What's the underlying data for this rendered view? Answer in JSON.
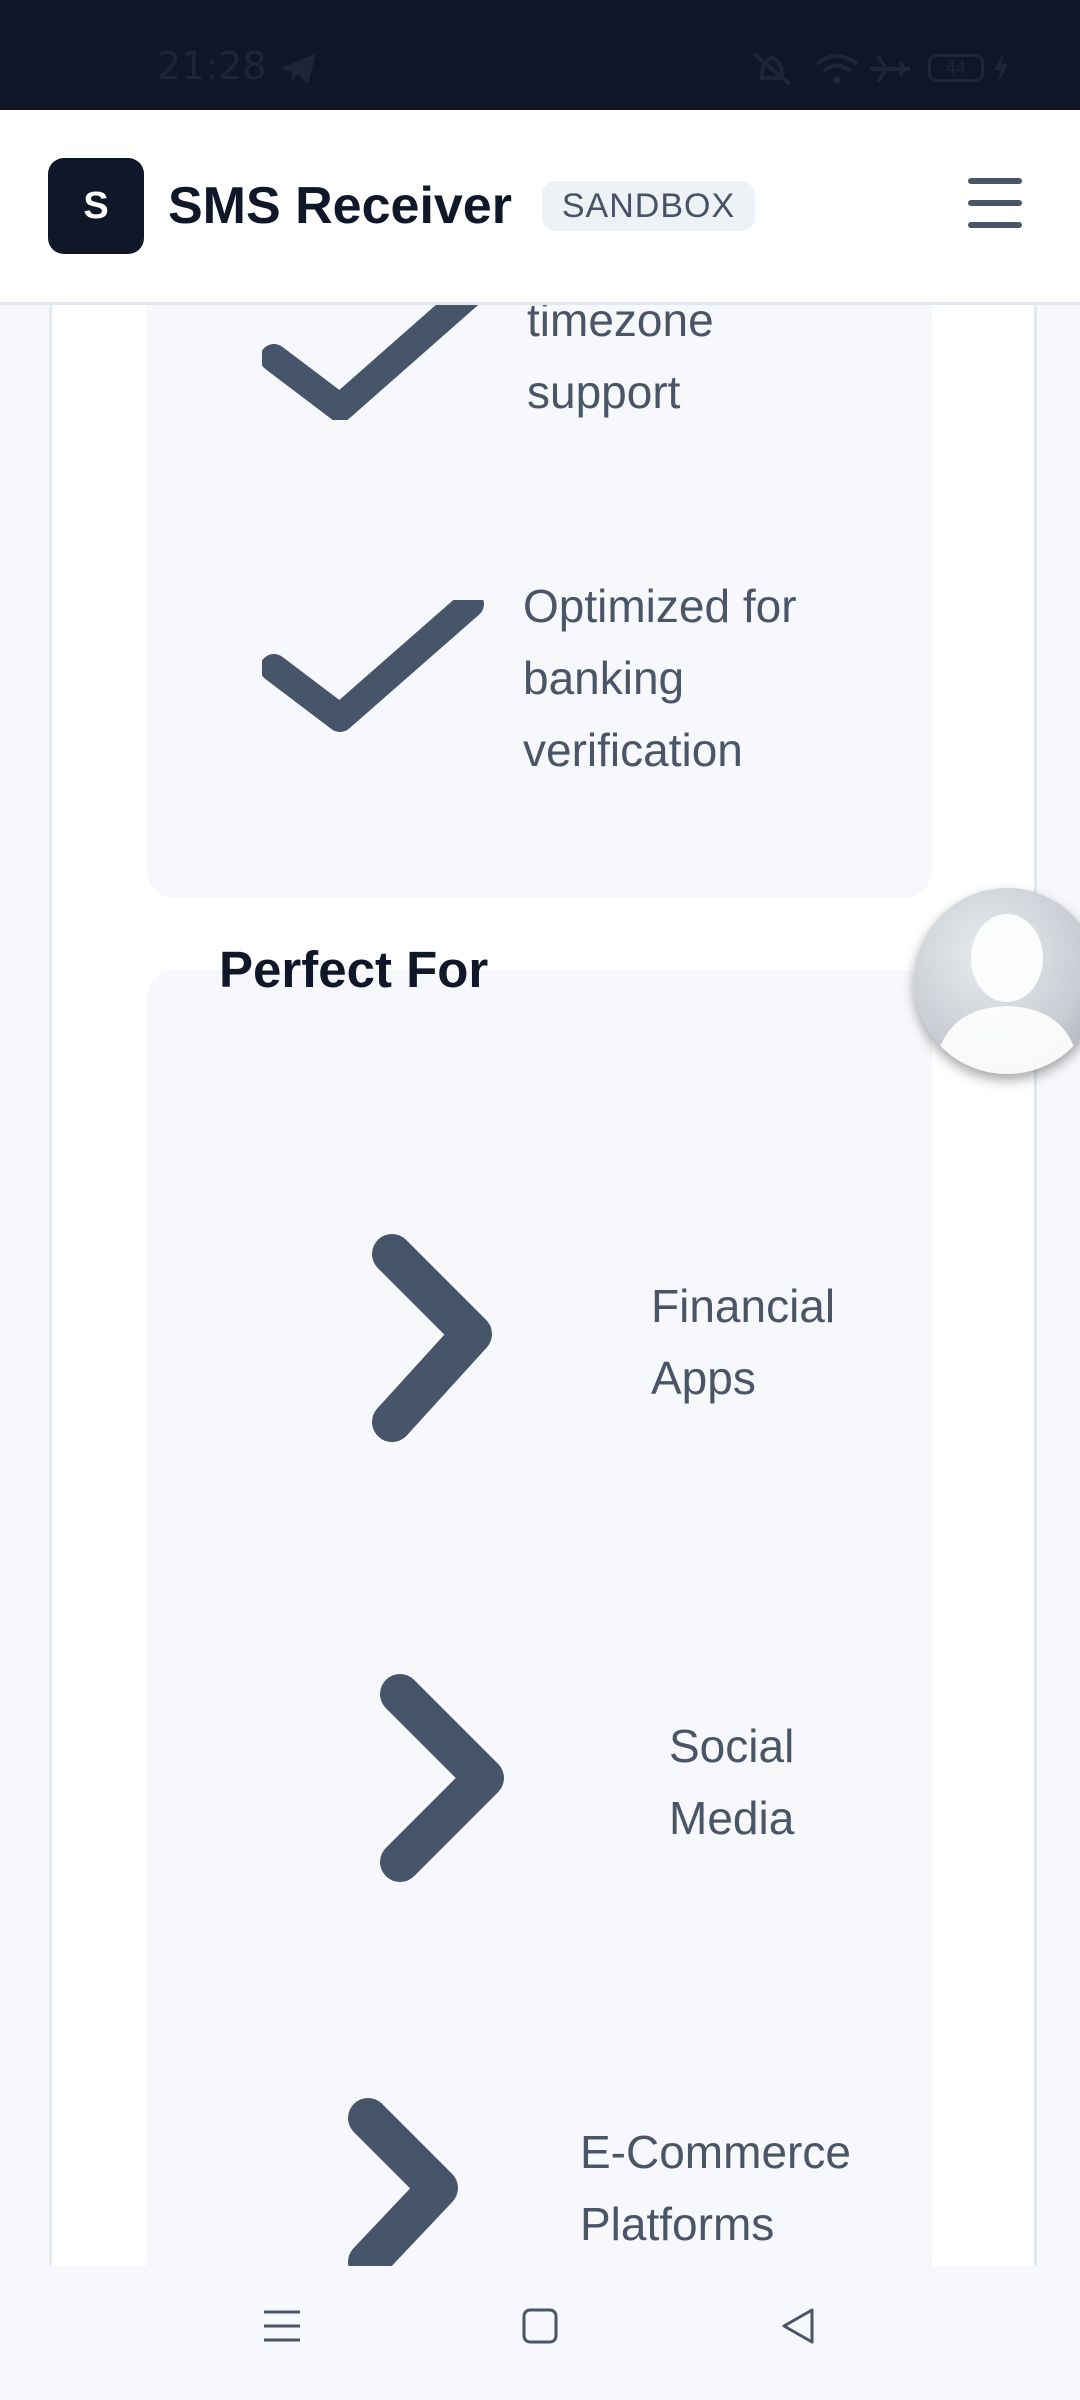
{
  "status_bar": {
    "time": "21:28",
    "icons": [
      "telegram-icon",
      "mute-icon",
      "wifi-icon",
      "airplane-mode-icon",
      "battery-icon",
      "charging-icon"
    ],
    "battery_level": "44"
  },
  "header": {
    "logo_letter": "S",
    "title": "SMS Receiver",
    "badge": "SANDBOX",
    "menu_icon": "hamburger-menu-icon"
  },
  "features": {
    "items": [
      {
        "label": "North America timezone support",
        "icon": "check-icon"
      },
      {
        "label": "Optimized for banking verification",
        "icon": "check-icon"
      }
    ]
  },
  "perfect_for": {
    "title": "Perfect For",
    "items": [
      {
        "label": "Financial Apps",
        "icon": "chevron-right-icon"
      },
      {
        "label": "Social Media",
        "icon": "chevron-right-icon"
      },
      {
        "label": "E-Commerce Platforms",
        "icon": "chevron-right-icon"
      }
    ]
  },
  "floating_avatar": {
    "icon": "user-avatar-icon"
  },
  "nav_bar": {
    "buttons": [
      "menu-nav-icon",
      "home-nav-icon",
      "back-nav-icon"
    ]
  },
  "colors": {
    "brand_dark": "#0f1728",
    "icon_gray": "#465569",
    "text_gray": "#4a5568",
    "background": "#f7f8fb"
  }
}
